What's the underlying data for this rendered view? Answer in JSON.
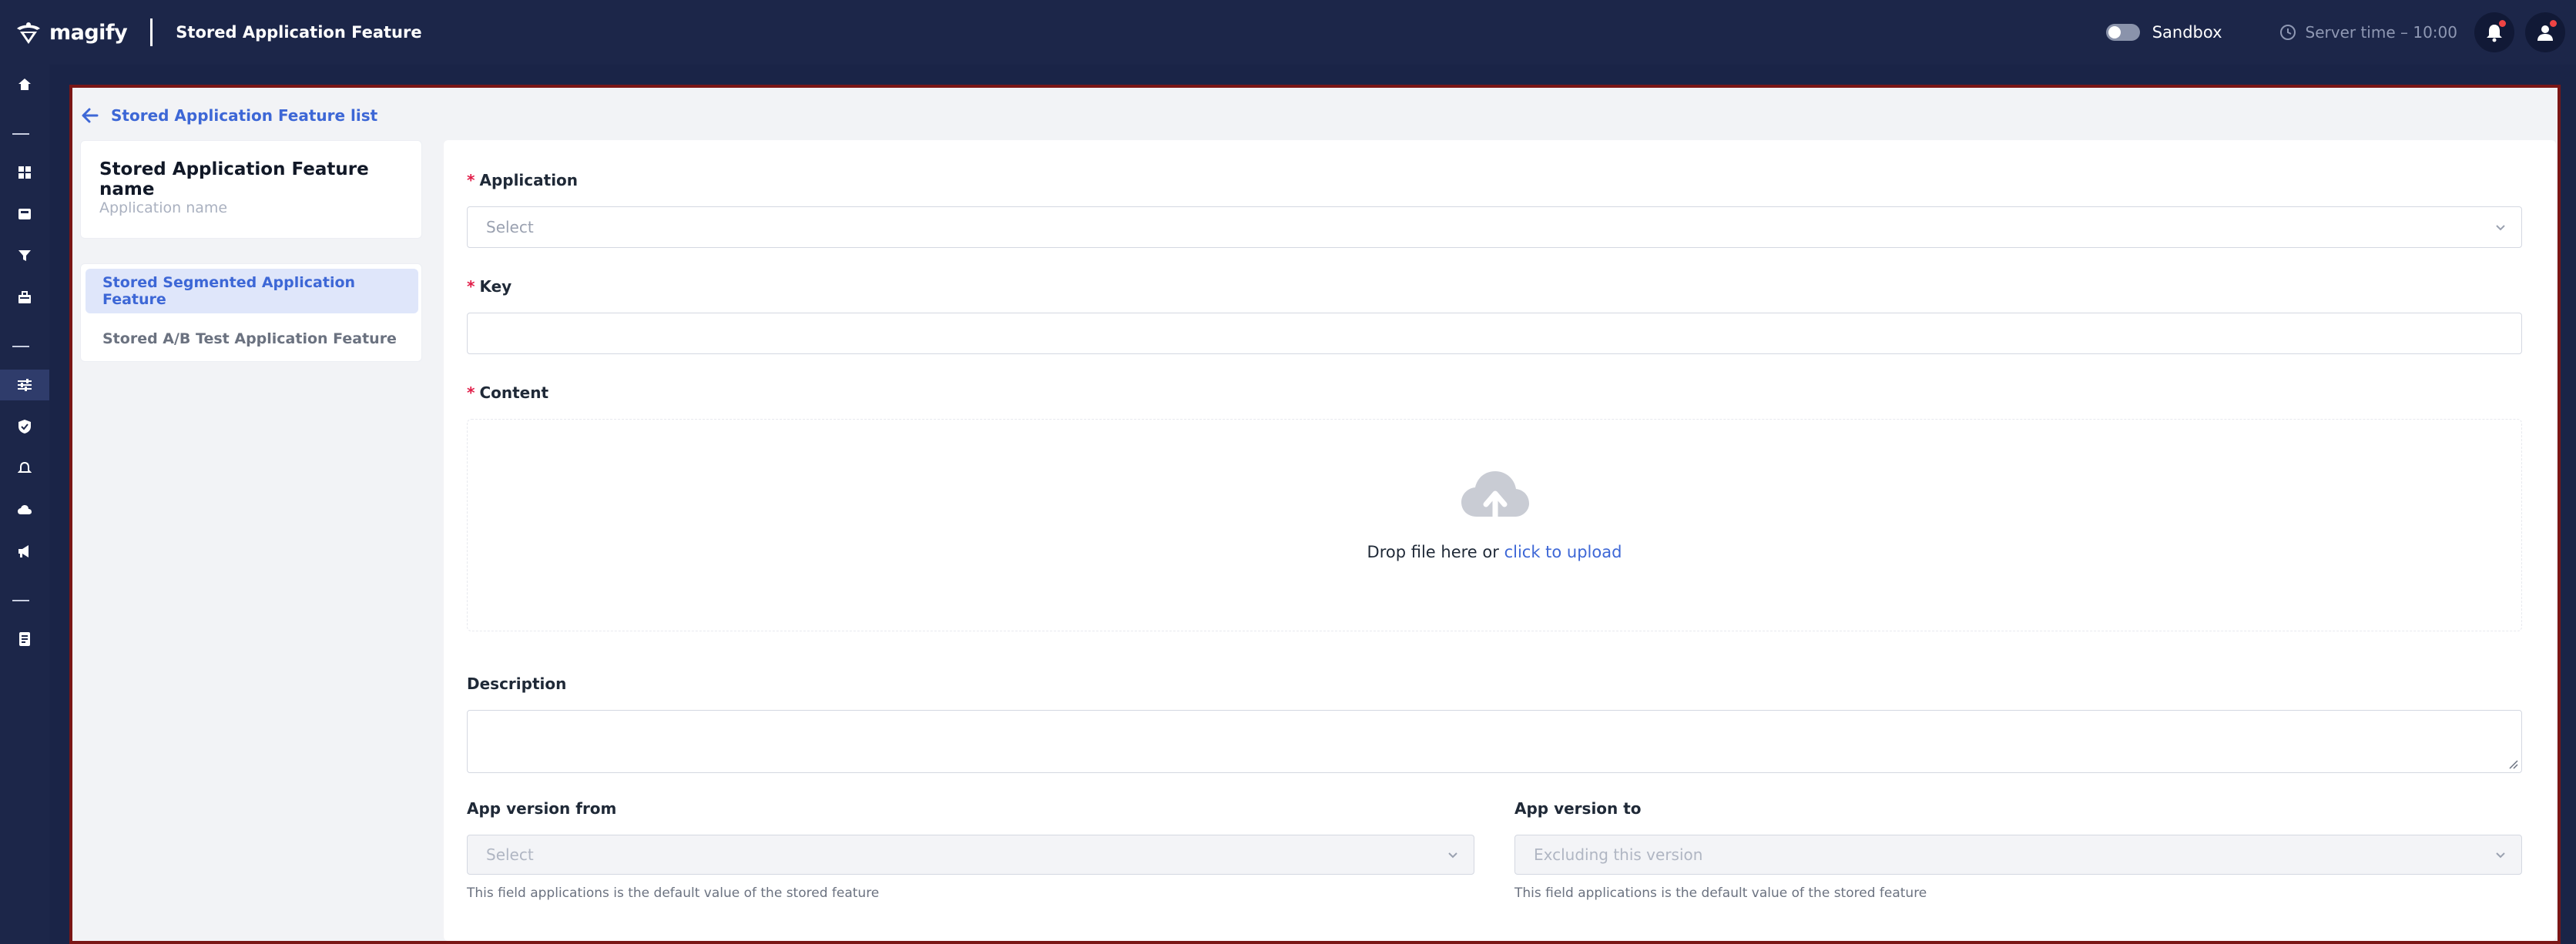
{
  "topbar": {
    "logo_text": "magify",
    "page_title": "Stored Application Feature",
    "sandbox_label": "Sandbox",
    "server_time": "Server time – 10:00"
  },
  "breadcrumb": {
    "back_label": "Stored Application Feature list"
  },
  "name_card": {
    "title": "Stored Application Feature name",
    "subtitle": "Application name"
  },
  "side_menu": {
    "items": [
      {
        "label": "Stored Segmented Application Feature",
        "active": true
      },
      {
        "label": "Stored A/B Test Application Feature",
        "active": false
      }
    ]
  },
  "form": {
    "application": {
      "label": "Application",
      "placeholder": "Select"
    },
    "key": {
      "label": "Key",
      "value": ""
    },
    "content": {
      "label": "Content",
      "drop_text": "Drop file here or ",
      "upload_link": "click to upload"
    },
    "description": {
      "label": "Description",
      "value": ""
    },
    "version_from": {
      "label": "App version from",
      "placeholder": "Select",
      "hint": "This field applications is the default value of the stored feature"
    },
    "version_to": {
      "label": "App version to",
      "placeholder": "Excluding this version",
      "hint": "This field applications is the default value of the stored feature"
    }
  },
  "colors": {
    "topbar": "#1c2649",
    "accent": "#3d67d6",
    "required": "#e11d48",
    "frame": "#7a1616"
  },
  "icons": [
    "home-icon",
    "dashboard-icon",
    "inbox-icon",
    "filter-icon",
    "bag-icon",
    "sliders-icon",
    "shield-icon",
    "bell-outline-icon",
    "cloud-icon",
    "megaphone-icon",
    "document-icon"
  ]
}
